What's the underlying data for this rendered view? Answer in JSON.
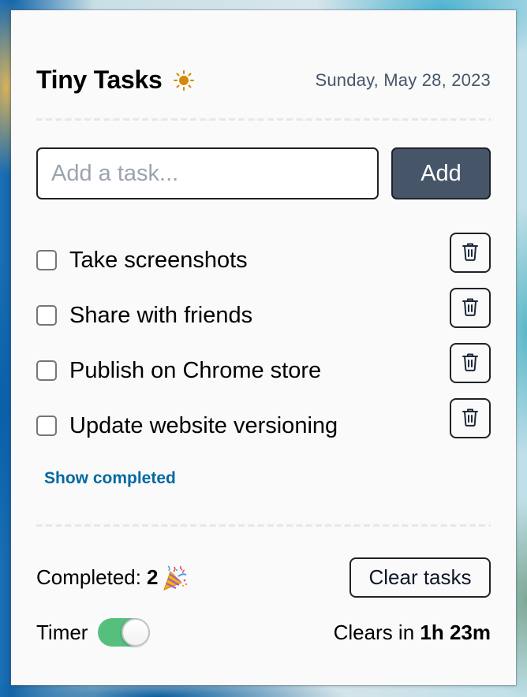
{
  "header": {
    "title": "Tiny Tasks",
    "theme_icon": "sun-icon",
    "date": "Sunday, May 28, 2023"
  },
  "add_task": {
    "placeholder": "Add a task...",
    "value": "",
    "button_label": "Add"
  },
  "tasks": [
    {
      "label": "Take screenshots",
      "checked": false
    },
    {
      "label": "Share with friends",
      "checked": false
    },
    {
      "label": "Publish on Chrome store",
      "checked": false
    },
    {
      "label": "Update website versioning",
      "checked": false
    }
  ],
  "show_completed_label": "Show completed",
  "footer": {
    "completed_label": "Completed:",
    "completed_count": "2",
    "completed_icon": "party-popper-icon",
    "clear_button_label": "Clear tasks",
    "timer_label": "Timer",
    "timer_enabled": true,
    "clears_in_label": "Clears in",
    "clears_in_value": "1h 23m"
  },
  "colors": {
    "accent": "#475569",
    "link": "#0369a1",
    "toggle_on": "#55c07d",
    "sun": "#d4890a",
    "date_text": "#475569"
  }
}
